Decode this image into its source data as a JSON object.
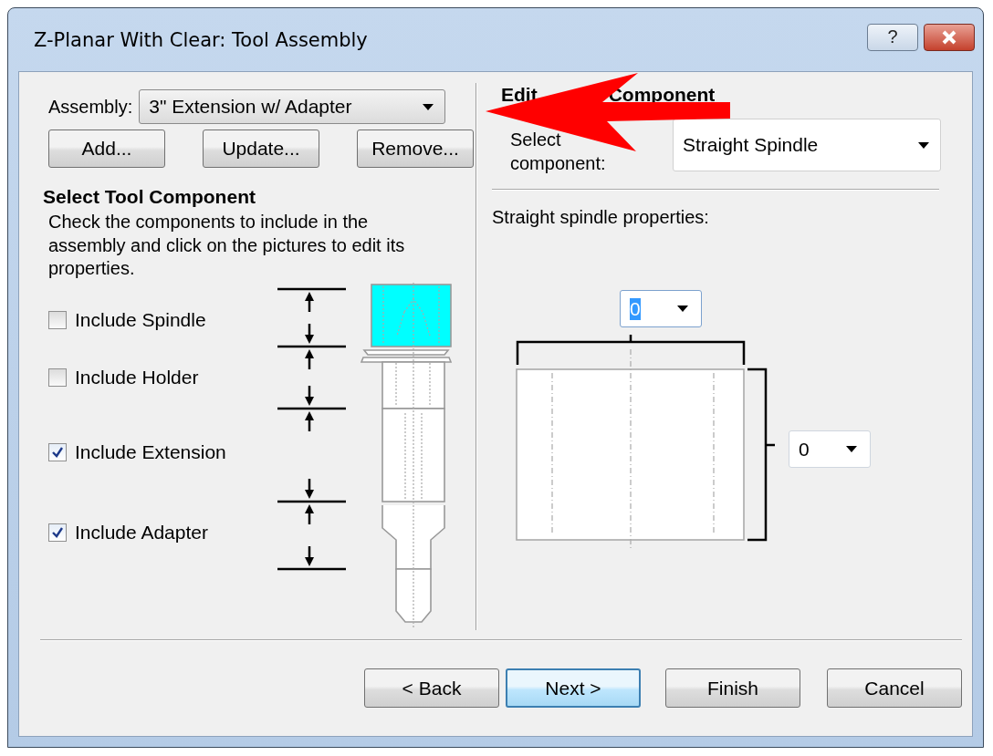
{
  "window": {
    "title": "Z-Planar With Clear: Tool Assembly",
    "help_button": "?"
  },
  "assembly": {
    "label": "Assembly:",
    "value": "3\" Extension w/ Adapter"
  },
  "assembly_buttons": [
    "Add...",
    "Update...",
    "Remove..."
  ],
  "select_section": {
    "heading": "Select Tool Component",
    "description": "Check the components to include in the assembly and click on the pictures to edit its properties."
  },
  "components": [
    {
      "label": "Include Spindle",
      "checked": false,
      "selected": true
    },
    {
      "label": "Include Holder",
      "checked": false,
      "selected": false
    },
    {
      "label": "Include Extension",
      "checked": true,
      "selected": false
    },
    {
      "label": "Include Adapter",
      "checked": true,
      "selected": false
    }
  ],
  "edit_section": {
    "heading_parts": [
      "Edit",
      "Component"
    ],
    "type_label_parts": [
      "Select",
      "component:"
    ],
    "type_value": "Straight Spindle",
    "properties_label": "Straight spindle properties:",
    "width_value": "0",
    "width_focused": true,
    "length_value": "0"
  },
  "nav_buttons": [
    {
      "label": "< Back",
      "default": false
    },
    {
      "label": "Next >",
      "default": true
    },
    {
      "label": "Finish",
      "default": false
    },
    {
      "label": "Cancel",
      "default": false
    }
  ]
}
